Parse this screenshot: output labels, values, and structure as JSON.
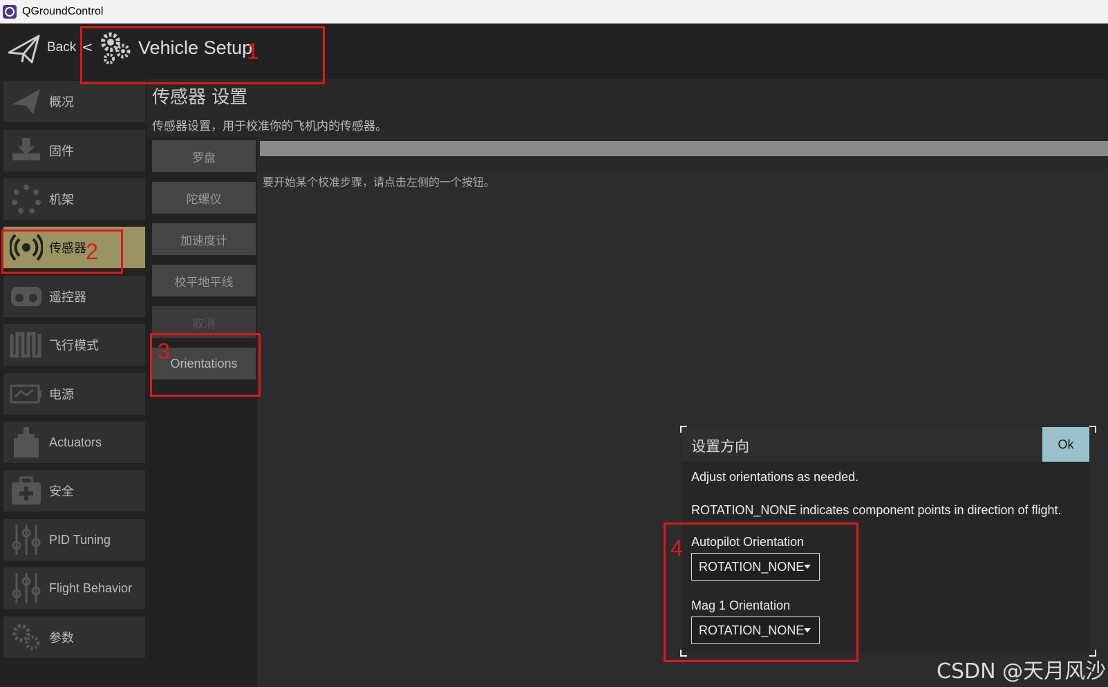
{
  "window": {
    "title": "QGroundControl"
  },
  "topbar": {
    "back_label": "Back",
    "separator": "<",
    "setup_title": "Vehicle Setup"
  },
  "sidebar": {
    "items": [
      {
        "label": "概况",
        "icon": "plane-icon"
      },
      {
        "label": "固件",
        "icon": "firmware-download-icon"
      },
      {
        "label": "机架",
        "icon": "airframe-icon"
      },
      {
        "label": "传感器",
        "icon": "sensors-icon",
        "active": true
      },
      {
        "label": "遥控器",
        "icon": "radio-icon"
      },
      {
        "label": "飞行模式",
        "icon": "flight-modes-icon"
      },
      {
        "label": "电源",
        "icon": "battery-icon"
      },
      {
        "label": "Actuators",
        "icon": "actuators-icon"
      },
      {
        "label": "安全",
        "icon": "safety-icon"
      },
      {
        "label": "PID Tuning",
        "icon": "sliders-icon"
      },
      {
        "label": "Flight Behavior",
        "icon": "sliders-icon"
      },
      {
        "label": "参数",
        "icon": "gears-icon"
      }
    ]
  },
  "panel": {
    "title": "传感器 设置",
    "description": "传感器设置，用于校准你的飞机内的传感器。",
    "instructions": "要开始某个校准步骤，请点击左侧的一个按钮。"
  },
  "calibration_buttons": [
    "罗盘",
    "陀螺仪",
    "加速度计",
    "校平地平线",
    "取消",
    "Orientations"
  ],
  "dialog": {
    "title": "设置方向",
    "ok_label": "Ok",
    "text1": "Adjust orientations as needed.",
    "text2": "ROTATION_NONE indicates component points in direction of flight.",
    "autopilot_label": "Autopilot Orientation",
    "autopilot_value": "ROTATION_NONE",
    "mag_label": "Mag 1 Orientation",
    "mag_value": "ROTATION_NONE"
  },
  "annotations": {
    "n1": "1",
    "n2": "2",
    "n3": "3",
    "n4": "4"
  },
  "watermark": "CSDN @天月风沙",
  "colors": {
    "active_item": "#9a9462",
    "ok_button": "#9bc2cc",
    "annotation_red": "#e01818"
  }
}
